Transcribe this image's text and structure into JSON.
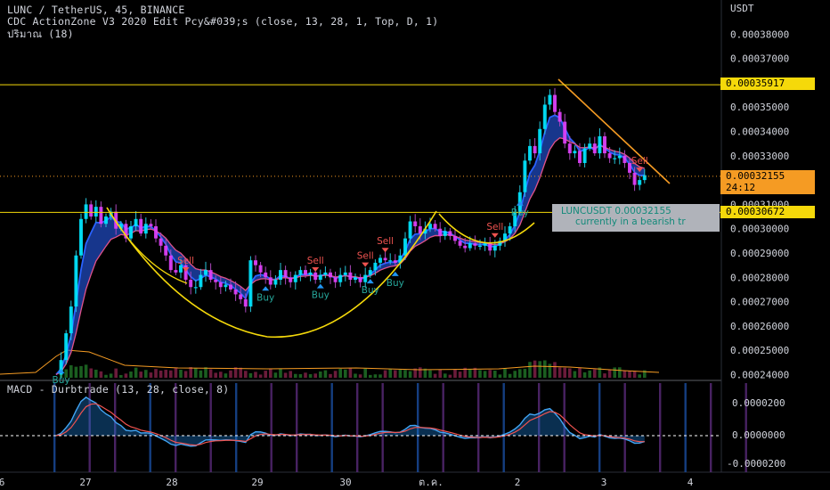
{
  "header": {
    "symbol_line": "LUNC / TetherUS, 45, BINANCE",
    "indicator_line": "CDC ActionZone V3 2020 Edit Pcy&#039;s (close, 13, 28, 1, Top, D, 1)",
    "volume_line": "ปริมาณ (18)"
  },
  "price_axis": {
    "currency": "USDT",
    "ticks": [
      "0.00038000",
      "0.00037000",
      "0.00035000",
      "0.00034000",
      "0.00033000",
      "0.00031000",
      "0.00030000",
      "0.00029000",
      "0.00028000",
      "0.00027000",
      "0.00026000",
      "0.00025000",
      "0.00024000"
    ]
  },
  "tags": {
    "resistance": "0.00035917",
    "current_price": "0.00032155",
    "countdown": "24:12",
    "support": "0.00030672"
  },
  "annotation": {
    "line1": "LUNCUSDT 0.00032155",
    "line2": "currently in a bearish tr"
  },
  "macd": {
    "label": "MACD - Durbtrade (13, 28, close, 8)",
    "ticks": [
      "0.0000200",
      "0.0000000",
      "-0.0000200"
    ]
  },
  "time_axis": {
    "ticks": [
      "6",
      "27",
      "28",
      "29",
      "30",
      "ต.ค.",
      "2",
      "3",
      "4"
    ]
  },
  "colors": {
    "background": "#000000",
    "horizontal_lines": "#f5d90a",
    "trend_line": "#f59b23",
    "pattern_curve": "#f5d90a",
    "band_fill": "#2962ff",
    "ema_fast": "#2962ff",
    "ema_slow": "#e0528a",
    "buy": "#26a69a",
    "sell": "#ef5350"
  },
  "chart_data": {
    "type": "candlestick",
    "ylim": [
      0.000236,
      0.000392
    ],
    "price_path": [
      [
        0,
        0.00024
      ],
      [
        1,
        0.000246
      ],
      [
        2,
        0.000257
      ],
      [
        3,
        0.000268
      ],
      [
        4,
        0.000289
      ],
      [
        5,
        0.000304
      ],
      [
        6,
        0.00031
      ],
      [
        7,
        0.000305
      ],
      [
        8,
        0.000309
      ],
      [
        9,
        0.000302
      ],
      [
        10,
        0.000305
      ],
      [
        11,
        0.000307
      ],
      [
        12,
        0.0003
      ],
      [
        13,
        0.000302
      ],
      [
        14,
        0.000296
      ],
      [
        15,
        0.000301
      ],
      [
        16,
        0.000304
      ],
      [
        17,
        0.000298
      ],
      [
        18,
        0.000302
      ],
      [
        19,
        0.000301
      ],
      [
        20,
        0.000296
      ],
      [
        21,
        0.000293
      ],
      [
        22,
        0.000289
      ],
      [
        23,
        0.000283
      ],
      [
        24,
        0.000282
      ],
      [
        25,
        0.000285
      ],
      [
        26,
        0.000279
      ],
      [
        27,
        0.000276
      ],
      [
        28,
        0.000276
      ],
      [
        29,
        0.000281
      ],
      [
        30,
        0.000283
      ],
      [
        31,
        0.000279
      ],
      [
        32,
        0.000278
      ],
      [
        33,
        0.000276
      ],
      [
        34,
        0.000277
      ],
      [
        35,
        0.000275
      ],
      [
        36,
        0.000273
      ],
      [
        37,
        0.000271
      ],
      [
        38,
        0.000268
      ],
      [
        39,
        0.000287
      ],
      [
        40,
        0.000285
      ],
      [
        41,
        0.000282
      ],
      [
        42,
        0.00028
      ],
      [
        43,
        0.000277
      ],
      [
        44,
        0.000279
      ],
      [
        45,
        0.000283
      ],
      [
        46,
        0.00028
      ],
      [
        47,
        0.000278
      ],
      [
        48,
        0.000281
      ],
      [
        49,
        0.000283
      ],
      [
        50,
        0.000281
      ],
      [
        51,
        0.000282
      ],
      [
        52,
        0.000279
      ],
      [
        53,
        0.000281
      ],
      [
        54,
        0.000282
      ],
      [
        55,
        0.00028
      ],
      [
        56,
        0.000278
      ],
      [
        57,
        0.000281
      ],
      [
        58,
        0.000282
      ],
      [
        59,
        0.000279
      ],
      [
        60,
        0.00028
      ],
      [
        61,
        0.000278
      ],
      [
        62,
        0.000281
      ],
      [
        63,
        0.000283
      ],
      [
        64,
        0.000286
      ],
      [
        65,
        0.000288
      ],
      [
        66,
        0.000287
      ],
      [
        67,
        0.000287
      ],
      [
        68,
        0.000286
      ],
      [
        69,
        0.000289
      ],
      [
        70,
        0.000296
      ],
      [
        71,
        0.000303
      ],
      [
        72,
        0.000301
      ],
      [
        73,
        0.000298
      ],
      [
        74,
        0.0003
      ],
      [
        75,
        0.000302
      ],
      [
        76,
        0.0003
      ],
      [
        77,
        0.000297
      ],
      [
        78,
        0.000299
      ],
      [
        79,
        0.000297
      ],
      [
        80,
        0.000295
      ],
      [
        81,
        0.000293
      ],
      [
        82,
        0.000292
      ],
      [
        83,
        0.000294
      ],
      [
        84,
        0.000293
      ],
      [
        85,
        0.000293
      ],
      [
        86,
        0.000294
      ],
      [
        87,
        0.000291
      ],
      [
        88,
        0.000293
      ],
      [
        89,
        0.000295
      ],
      [
        90,
        0.000298
      ],
      [
        91,
        0.000301
      ],
      [
        92,
        0.000307
      ],
      [
        93,
        0.000315
      ],
      [
        94,
        0.000328
      ],
      [
        95,
        0.000334
      ],
      [
        96,
        0.000331
      ],
      [
        97,
        0.000341
      ],
      [
        98,
        0.000351
      ],
      [
        99,
        0.000355
      ],
      [
        100,
        0.000348
      ],
      [
        101,
        0.000344
      ],
      [
        102,
        0.000335
      ],
      [
        103,
        0.000331
      ],
      [
        104,
        0.000332
      ],
      [
        105,
        0.000327
      ],
      [
        106,
        0.000333
      ],
      [
        107,
        0.000335
      ],
      [
        108,
        0.000331
      ],
      [
        109,
        0.000338
      ],
      [
        110,
        0.000331
      ],
      [
        111,
        0.000329
      ],
      [
        112,
        0.000329
      ],
      [
        113,
        0.00033
      ],
      [
        114,
        0.000327
      ],
      [
        115,
        0.000323
      ],
      [
        116,
        0.000318
      ],
      [
        117,
        0.00032
      ],
      [
        118,
        0.000322
      ]
    ],
    "horizontal_levels": [
      0.00035917,
      0.00030672,
      0.00032155
    ],
    "signals": [
      {
        "label": "Buy",
        "i": 1,
        "side": "buy"
      },
      {
        "label": "Sell",
        "i": 26,
        "side": "sell"
      },
      {
        "label": "Buy",
        "i": 42,
        "side": "buy"
      },
      {
        "label": "Sell",
        "i": 52,
        "side": "sell"
      },
      {
        "label": "Buy",
        "i": 53,
        "side": "buy"
      },
      {
        "label": "Sell",
        "i": 62,
        "side": "sell"
      },
      {
        "label": "Buy",
        "i": 63,
        "side": "buy"
      },
      {
        "label": "Sell",
        "i": 66,
        "side": "sell"
      },
      {
        "label": "Buy",
        "i": 68,
        "side": "buy"
      },
      {
        "label": "Sell",
        "i": 88,
        "side": "sell"
      },
      {
        "label": "Buy",
        "i": 93,
        "side": "buy"
      },
      {
        "label": "Sell",
        "i": 117,
        "side": "sell"
      }
    ]
  }
}
